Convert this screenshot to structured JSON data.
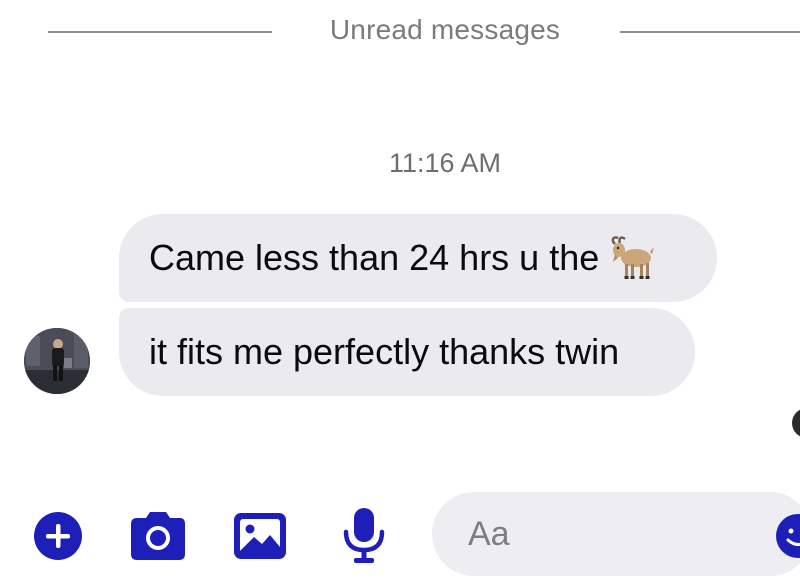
{
  "divider": {
    "label": "Unread messages"
  },
  "conversation": {
    "timestamp": "11:16 AM",
    "messages": [
      {
        "text": "Came less than 24 hrs u the",
        "emoji": "goat-emoji"
      },
      {
        "text": "it fits me perfectly thanks twin"
      }
    ]
  },
  "composer": {
    "placeholder": "Aa",
    "tools": [
      "add-icon",
      "camera-icon",
      "photo-icon",
      "microphone-icon"
    ],
    "emoji_button": "smiley-icon"
  },
  "colors": {
    "accent": "#1d1fb8",
    "bubble": "#eaeaef",
    "compose_bg": "#eeeef2",
    "divider_text": "#7a7a7f"
  }
}
